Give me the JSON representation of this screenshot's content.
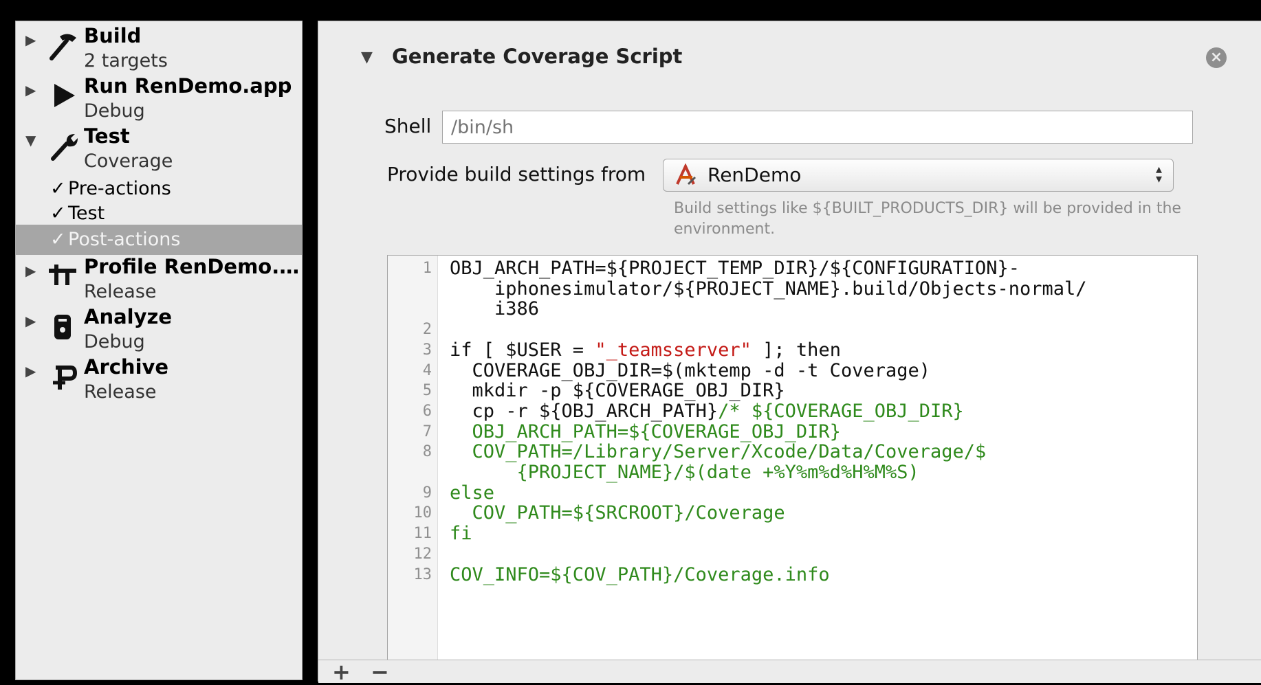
{
  "sidebar": {
    "actions": [
      {
        "name": "Build",
        "sub": "2 targets",
        "icon": "hammer-icon"
      },
      {
        "name": "Run RenDemo.app",
        "sub": "Debug",
        "icon": "play-icon"
      },
      {
        "name": "Test",
        "sub": "Coverage",
        "icon": "wrench-icon",
        "expanded": true
      },
      {
        "name": "Profile RenDemo.…",
        "sub": "Release",
        "icon": "caliper-icon"
      },
      {
        "name": "Analyze",
        "sub": "Debug",
        "icon": "analyze-icon"
      },
      {
        "name": "Archive",
        "sub": "Release",
        "icon": "archive-icon"
      }
    ],
    "test_phases": [
      {
        "label": "Pre-actions",
        "check": "✓"
      },
      {
        "label": "Test",
        "check": "✓"
      },
      {
        "label": "Post-actions",
        "check": "✓",
        "selected": true
      }
    ]
  },
  "detail": {
    "section_title": "Generate Coverage Script",
    "shell_label": "Shell",
    "shell_placeholder": "/bin/sh",
    "provide_label": "Provide build settings from",
    "provide_value": "RenDemo",
    "hint": "Build settings like ${BUILT_PRODUCTS_DIR} will be provided in the environment.",
    "code_lines": [
      {
        "n": "1",
        "parts": [
          {
            "t": "OBJ_ARCH_PATH=${PROJECT_TEMP_DIR}/${CONFIGURATION}-"
          }
        ]
      },
      {
        "n": "",
        "parts": [
          {
            "t": "    iphonesimulator/${PROJECT_NAME}.build/Objects-normal/"
          }
        ]
      },
      {
        "n": "",
        "parts": [
          {
            "t": "    i386"
          }
        ]
      },
      {
        "n": "2",
        "parts": [
          {
            "t": ""
          }
        ]
      },
      {
        "n": "3",
        "parts": [
          {
            "t": "if [ $USER = "
          },
          {
            "t": "\"_teamsserver\"",
            "c": "str"
          },
          {
            "t": " ]; then"
          }
        ]
      },
      {
        "n": "4",
        "parts": [
          {
            "t": "  COVERAGE_OBJ_DIR=$(mktemp -d -t Coverage)"
          }
        ]
      },
      {
        "n": "5",
        "parts": [
          {
            "t": "  mkdir -p ${COVERAGE_OBJ_DIR}"
          }
        ]
      },
      {
        "n": "6",
        "parts": [
          {
            "t": "  cp -r ${OBJ_ARCH_PATH}"
          },
          {
            "t": "/* ${COVERAGE_OBJ_DIR}",
            "c": "cmt"
          }
        ]
      },
      {
        "n": "7",
        "parts": [
          {
            "t": "  OBJ_ARCH_PATH=${COVERAGE_OBJ_DIR}",
            "c": "cmt"
          }
        ]
      },
      {
        "n": "8",
        "parts": [
          {
            "t": "  COV_PATH=/Library/Server/Xcode/Data/Coverage/$",
            "c": "cmt"
          }
        ]
      },
      {
        "n": "",
        "parts": [
          {
            "t": "      {PROJECT_NAME}/$(date +%Y%m%d%H%M%S)",
            "c": "cmt"
          }
        ]
      },
      {
        "n": "9",
        "parts": [
          {
            "t": "else",
            "c": "cmt"
          }
        ]
      },
      {
        "n": "10",
        "parts": [
          {
            "t": "  COV_PATH=${SRCROOT}/Coverage",
            "c": "cmt"
          }
        ]
      },
      {
        "n": "11",
        "parts": [
          {
            "t": "fi",
            "c": "cmt"
          }
        ]
      },
      {
        "n": "12",
        "parts": [
          {
            "t": ""
          }
        ]
      },
      {
        "n": "13",
        "parts": [
          {
            "t": "COV_INFO=${COV_PATH}/Coverage.info",
            "c": "cmt"
          }
        ]
      }
    ],
    "add_label": "+",
    "remove_label": "−",
    "close_label": "×"
  }
}
